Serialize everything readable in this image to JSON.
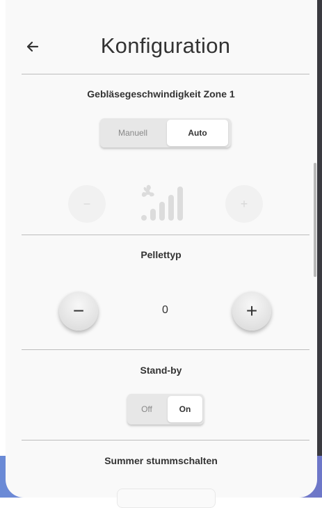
{
  "header": {
    "title": "Konfiguration",
    "back_icon": "arrow-left-icon"
  },
  "fan_speed": {
    "title": "Gebläsegeschwindigkeit Zone 1",
    "toggle": {
      "options": [
        "Manuell",
        "Auto"
      ],
      "selected": "Auto"
    },
    "minus_label": "−",
    "plus_label": "+",
    "icon": "fan-speed-icon",
    "enabled": false
  },
  "pellet_type": {
    "title": "Pellettyp",
    "value": "0",
    "minus_label": "−",
    "plus_label": "+"
  },
  "standby": {
    "title": "Stand-by",
    "toggle": {
      "options": [
        "Off",
        "On"
      ],
      "selected": "On"
    }
  },
  "buzzer": {
    "title": "Summer stummschalten"
  },
  "colors": {
    "card_background": "#f9f9f9",
    "divider": "#bdbdbd",
    "disabled_icon": "#dcdcdc",
    "text": "#333333"
  }
}
